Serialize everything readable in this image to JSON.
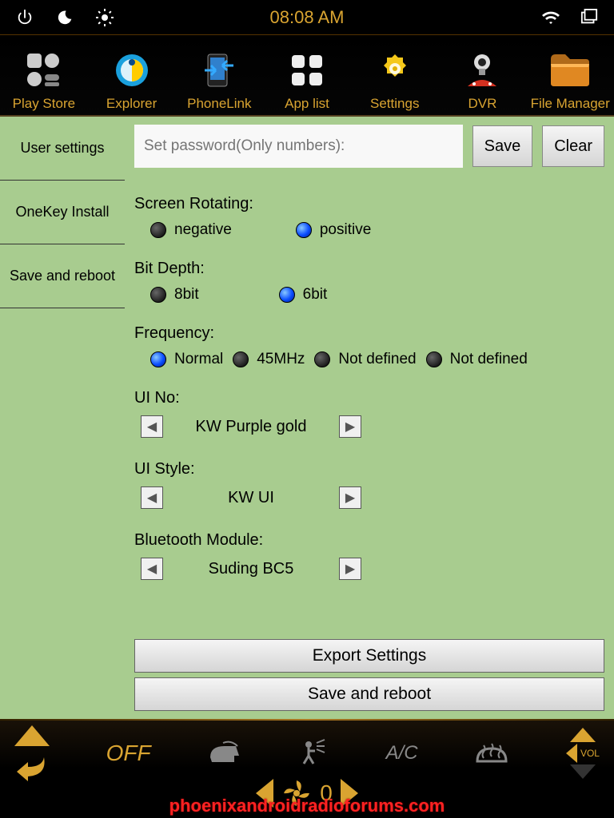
{
  "status": {
    "time": "08:08 AM",
    "icons": {
      "power": "power-icon",
      "night": "night-icon",
      "brightness": "brightness-icon",
      "wifi": "wifi-icon",
      "windows": "windows-icon"
    }
  },
  "appbar": [
    {
      "label": "Play Store"
    },
    {
      "label": "Explorer"
    },
    {
      "label": "PhoneLink"
    },
    {
      "label": "App list"
    },
    {
      "label": "Settings"
    },
    {
      "label": "DVR"
    },
    {
      "label": "File Manager"
    }
  ],
  "sidebar": [
    {
      "label": "User settings"
    },
    {
      "label": "OneKey Install"
    },
    {
      "label": "Save and reboot"
    }
  ],
  "password": {
    "placeholder": "Set password(Only numbers):",
    "save": "Save",
    "clear": "Clear"
  },
  "settings": {
    "screen_rotating": {
      "label": "Screen Rotating:",
      "options": [
        "negative",
        "positive"
      ],
      "selected": 1
    },
    "bit_depth": {
      "label": "Bit Depth:",
      "options": [
        "8bit",
        "6bit"
      ],
      "selected": 1
    },
    "frequency": {
      "label": "Frequency:",
      "options": [
        "Normal",
        "45MHz",
        "Not defined",
        "Not defined"
      ],
      "selected": 0
    },
    "ui_no": {
      "label": "UI No:",
      "value": "KW Purple gold"
    },
    "ui_style": {
      "label": "UI Style:",
      "value": "KW UI"
    },
    "bluetooth": {
      "label": "Bluetooth Module:",
      "value": "Suding BC5"
    }
  },
  "footer_buttons": {
    "export": "Export Settings",
    "save_reboot": "Save and reboot"
  },
  "bottombar": {
    "off": "OFF",
    "ac": "A/C",
    "fan_value": "0",
    "vol": "VOL"
  },
  "watermark": "phoenixandroidradioforums.com"
}
